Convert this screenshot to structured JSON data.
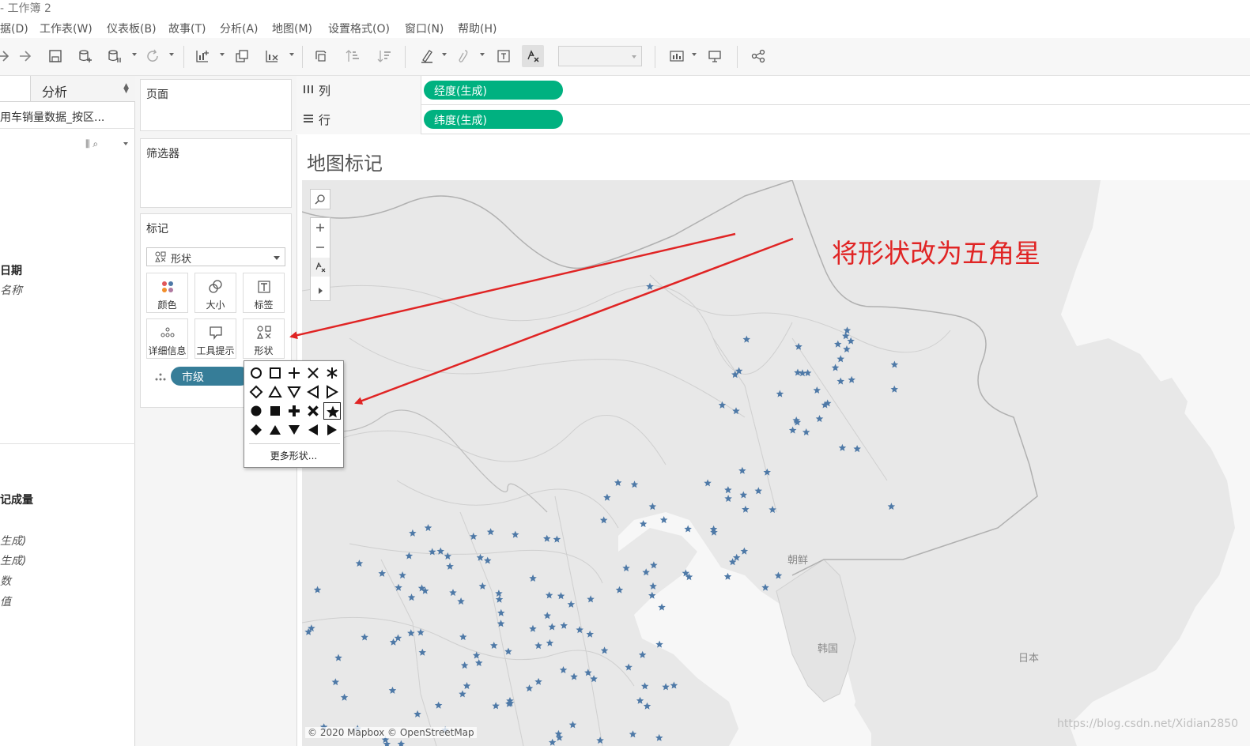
{
  "window": {
    "title": "- 工作簿 2"
  },
  "menu": [
    {
      "label": "据(D)"
    },
    {
      "label": "工作表(W)"
    },
    {
      "label": "仪表板(B)"
    },
    {
      "label": "故事(T)"
    },
    {
      "label": "分析(A)"
    },
    {
      "label": "地图(M)"
    },
    {
      "label": "设置格式(O)"
    },
    {
      "label": "窗口(N)"
    },
    {
      "label": "帮助(H)"
    }
  ],
  "toolbar": {
    "icons": [
      "undo-icon",
      "redo-icon",
      "save-icon",
      "new-datasource-icon",
      "pause-update-icon",
      "refresh-icon",
      "new-worksheet-icon",
      "duplicate-sheet-icon",
      "clear-sheet-icon",
      "swap-icon",
      "sort-ascending-icon",
      "sort-descending-icon",
      "highlight-icon",
      "group-icon",
      "show-labels-icon",
      "fix-axes-icon",
      "show-me-icon",
      "presentation-icon",
      "share-icon"
    ],
    "fit_select_value": ""
  },
  "left_pane": {
    "analysis_tab": "分析",
    "data_source": "用车销量数据_按区...",
    "dimensions": [
      {
        "label": "日期",
        "style": "bold"
      },
      {
        "label": "名称",
        "style": "italic"
      }
    ],
    "measures": [
      {
        "label": "记成量",
        "style": "bold"
      },
      {
        "label": "生成)",
        "style": "italic"
      },
      {
        "label": "生成)",
        "style": "italic"
      },
      {
        "label": "数",
        "style": "italic"
      },
      {
        "label": "值",
        "style": "italic"
      }
    ]
  },
  "cards": {
    "pages": "页面",
    "filters": "筛选器",
    "marks": "标记",
    "mark_type": "形状",
    "buttons": [
      {
        "label": "颜色",
        "icon": "color-icon"
      },
      {
        "label": "大小",
        "icon": "size-icon"
      },
      {
        "label": "标签",
        "icon": "label-icon"
      },
      {
        "label": "详细信息",
        "icon": "detail-icon"
      },
      {
        "label": "工具提示",
        "icon": "tooltip-icon"
      },
      {
        "label": "形状",
        "icon": "shape-icon"
      }
    ],
    "marks_pill": "市级"
  },
  "shelves": {
    "columns_label": "列",
    "columns_pill": "经度(生成)",
    "rows_label": "行",
    "rows_pill": "纬度(生成)"
  },
  "view": {
    "title": "地图标记",
    "attribution": "© 2020 Mapbox © OpenStreetMap",
    "country_labels": [
      "朝鲜",
      "韩国",
      "日本"
    ],
    "watermark": "https://blog.csdn.net/Xidian2850",
    "mark_color": "#4e79a7",
    "mark_shape": "star"
  },
  "shape_picker": {
    "shapes": [
      "circle-outline",
      "square-outline",
      "plus",
      "cross",
      "asterisk",
      "diamond-outline",
      "triangle-up-outline",
      "triangle-down-outline",
      "triangle-left-outline",
      "triangle-right-outline",
      "circle-filled",
      "square-filled",
      "plus-filled",
      "cross-filled",
      "star-filled",
      "diamond-filled",
      "triangle-up-filled",
      "triangle-down-filled",
      "triangle-left-filled",
      "triangle-right-filled"
    ],
    "selected": "star-filled",
    "more_label": "更多形状..."
  },
  "annotation": {
    "text": "将形状改为五角星",
    "color": "#e02424"
  },
  "colors": {
    "green_pill": "#00b180",
    "blue_pill": "#367d98"
  }
}
